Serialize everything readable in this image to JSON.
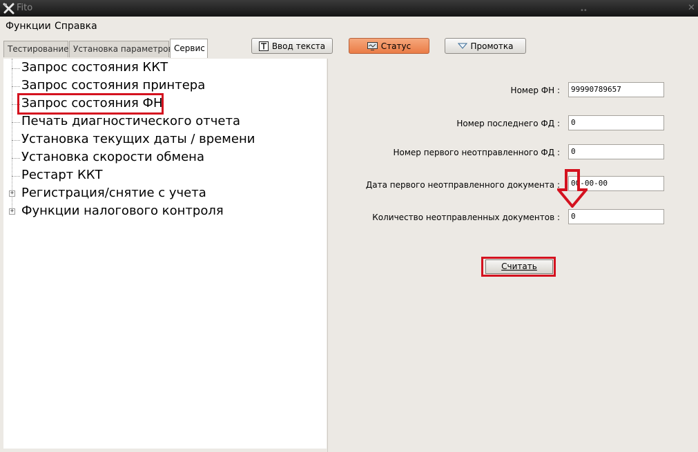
{
  "window": {
    "title": "Fito",
    "grip": "••"
  },
  "menu": {
    "items": [
      "Функции",
      "Справка"
    ]
  },
  "tabs": [
    {
      "label": "Тестирование",
      "active": false
    },
    {
      "label": "Установка параметров",
      "active": false
    },
    {
      "label": "Сервис",
      "active": true
    }
  ],
  "toolbar": {
    "text_input_label": "Ввод текста",
    "status_label": "Статус",
    "feed_label": "Промотка",
    "active_color": "#ea7c46"
  },
  "tree": {
    "items": [
      {
        "label": "Запрос состояния ККТ",
        "expandable": false
      },
      {
        "label": "Запрос состояния принтера",
        "expandable": false
      },
      {
        "label": "Запрос состояния ФН",
        "expandable": false,
        "highlighted": true
      },
      {
        "label": "Печать диагностического отчета",
        "expandable": false
      },
      {
        "label": "Установка текущих даты / времени",
        "expandable": false
      },
      {
        "label": "Установка скорости обмена",
        "expandable": false
      },
      {
        "label": "Рестарт ККТ",
        "expandable": false
      },
      {
        "label": "Регистрация/снятие с учета",
        "expandable": true
      },
      {
        "label": "Функции налогового контроля",
        "expandable": true
      }
    ]
  },
  "form": {
    "fields": [
      {
        "label": "Номер ФН :",
        "value": "99990789657"
      },
      {
        "label": "Номер последнего ФД :",
        "value": "0"
      },
      {
        "label": "Номер первого неотправленного ФД :",
        "value": "0"
      },
      {
        "label": "Дата первого неотправленного документа :",
        "value": "00-00-00"
      },
      {
        "label": "Количество неотправленных документов :",
        "value": "0"
      }
    ],
    "read_button": "Считать"
  },
  "annotation_color": "#d4121f"
}
